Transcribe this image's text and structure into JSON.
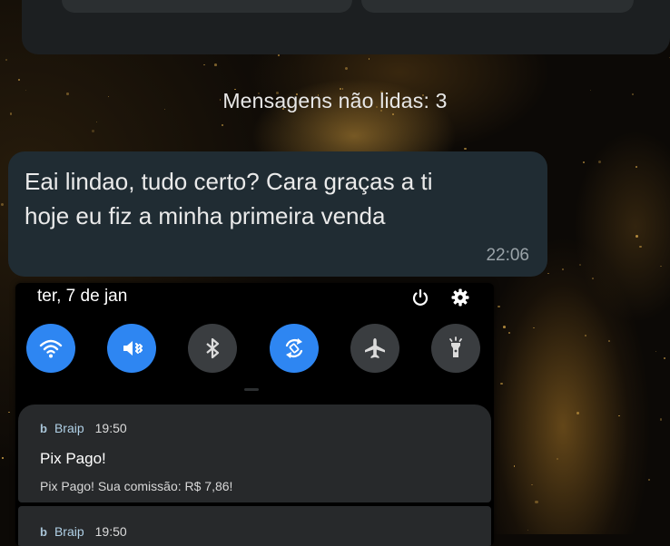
{
  "chat": {
    "unread_label": "Mensagens não lidas: 3",
    "message": {
      "text": "Eai lindao, tudo certo? Cara graças a ti\nhoje eu fiz a minha primeira venda",
      "time": "22:06"
    }
  },
  "screenshot": {
    "date": "ter, 7 de jan",
    "actions": [
      {
        "icon": "power-icon"
      },
      {
        "icon": "gear-icon"
      }
    ],
    "quick_settings": [
      {
        "icon": "wifi-icon",
        "state": "on"
      },
      {
        "icon": "vibrate-mute-icon",
        "state": "on"
      },
      {
        "icon": "bluetooth-icon",
        "state": "off"
      },
      {
        "icon": "auto-rotate-icon",
        "state": "on"
      },
      {
        "icon": "airplane-icon",
        "state": "off"
      },
      {
        "icon": "flashlight-icon",
        "state": "off"
      }
    ],
    "notifications": [
      {
        "app_glyph": "b",
        "app": "Braip",
        "time": "19:50",
        "title": "Pix Pago!",
        "body": "Pix Pago! Sua comissão: R$ 7,86!"
      },
      {
        "app_glyph": "b",
        "app": "Braip",
        "time": "19:50"
      }
    ]
  },
  "colors": {
    "bubble": "#202c33",
    "tile_on": "#2e86f2",
    "tile_off": "#3a3d40",
    "notification_bg": "#27292b"
  }
}
